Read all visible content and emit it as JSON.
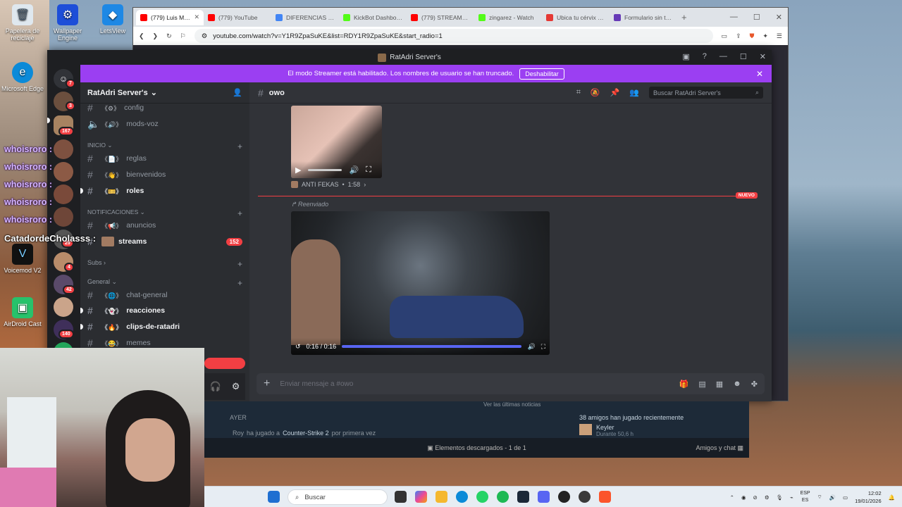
{
  "desktop": {
    "icons": [
      {
        "label": "Papelera de reciclaje",
        "icon": "recycle-bin-icon"
      },
      {
        "label": "Wallpaper Engine",
        "icon": "wallpaper-engine-icon"
      },
      {
        "label": "LetsView",
        "icon": "letsview-icon"
      },
      {
        "label": "Microsoft Edge",
        "icon": "edge-icon"
      },
      {
        "label": "Voicemod V2",
        "icon": "voicemod-icon"
      },
      {
        "label": "AirDroid Cast",
        "icon": "airdroid-icon"
      }
    ]
  },
  "overlay_chat": {
    "names": [
      "whoisroro :",
      "whoisroro :",
      "whoisroro :",
      "whoisroro :",
      "whoisroro :"
    ],
    "highlight": "CatadordeCholasss :"
  },
  "browser": {
    "tabs": [
      {
        "label": "(779) Luis Mig...",
        "color": "#ff0000",
        "active": true
      },
      {
        "label": "(779) YouTube",
        "color": "#ff0000"
      },
      {
        "label": "DIFERENCIAS ENT...",
        "color": "#4285f4"
      },
      {
        "label": "KickBot Dashboar...",
        "color": "#53fc18"
      },
      {
        "label": "(779) STREAMERS...",
        "color": "#ff0000"
      },
      {
        "label": "zingarez - Watch",
        "color": "#53fc18"
      },
      {
        "label": "Ubica tu cérvix e...",
        "color": "#e53935"
      },
      {
        "label": "Formulario sin tít...",
        "color": "#673ab7"
      }
    ],
    "url": "youtube.com/watch?v=Y1R9ZpaSuKE&list=RDY1R9ZpaSuKE&start_radio=1"
  },
  "discord": {
    "window_title": "RatAdri Server's",
    "banner": {
      "text": "El modo Streamer está habilitado. Los nombres de usuario se han truncado.",
      "button": "Deshabilitar"
    },
    "server_name": "RatAdri Server's",
    "guild_badges": [
      "7",
      "3",
      "167",
      "29",
      "4",
      "42",
      "140"
    ],
    "channels": [
      {
        "name": "config",
        "emoji": "《⚙》",
        "type": "text"
      },
      {
        "name": "mods-voz",
        "emoji": "《🔊》",
        "type": "voice"
      }
    ],
    "categories": [
      {
        "name": "INICIO",
        "channels": [
          {
            "name": "reglas",
            "emoji": "《📄》"
          },
          {
            "name": "bienvenidos",
            "emoji": "《👋》"
          },
          {
            "name": "roles",
            "emoji": "《🎫》",
            "unread": true
          }
        ]
      },
      {
        "name": "NOTIFICACIONES",
        "channels": [
          {
            "name": "anuncios",
            "emoji": "《📢》"
          },
          {
            "name": "streams",
            "emoji": "",
            "unread": true,
            "badge": "152"
          }
        ]
      },
      {
        "name": "Subs",
        "channels": []
      },
      {
        "name": "General",
        "channels": [
          {
            "name": "chat-general",
            "emoji": "《🌐》"
          },
          {
            "name": "reacciones",
            "emoji": "《👻》",
            "unread": true
          },
          {
            "name": "clips-de-ratadri",
            "emoji": "《🔥》",
            "unread": true
          },
          {
            "name": "memes",
            "emoji": "《😂》"
          }
        ]
      }
    ],
    "channel_name": "owo",
    "search_placeholder": "Buscar RatAdri Server's",
    "messages": {
      "embed_author": "ANTI FEKAS",
      "embed_duration": "1:58",
      "new_label": "NUEVO",
      "forwarded": "Reenviado",
      "video_time": "0:16 / 0:16"
    },
    "composer_placeholder": "Enviar mensaje a #owo"
  },
  "steam": {
    "ver_noticias": "Ver las últimas noticias",
    "ayer": "AYER",
    "activity_user": "Roy",
    "activity_text": "ha jugado a",
    "activity_game": "Counter-Strike 2",
    "activity_suffix": "por primera vez",
    "friends_played": "38 amigos han jugado recientemente",
    "friend_name": "Keyler",
    "friend_status": "Durante 50,6 h",
    "downloads": "Elementos descargados - 1 de 1",
    "friends_chat": "Amigos y chat"
  },
  "taskbar": {
    "search": "Buscar",
    "lang_top": "ESP",
    "lang_bottom": "ES",
    "time": "12:02",
    "date": "19/01/2026"
  }
}
